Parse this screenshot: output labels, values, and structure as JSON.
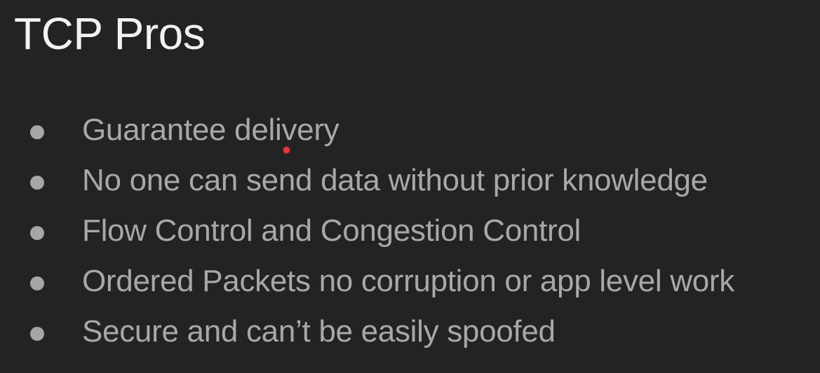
{
  "slide": {
    "title": "TCP Pros",
    "bullets": [
      "Guarantee delivery",
      "No one can send data without prior knowledge",
      "Flow Control and Congestion Control",
      "Ordered Packets no corruption or app level work",
      "Secure and can’t be easily spoofed"
    ]
  },
  "colors": {
    "background": "#232323",
    "title": "#f2f2f2",
    "bullet_text": "#a8a8a8",
    "bullet_dot": "#a6a6a6",
    "laser_pointer": "#e8383d"
  }
}
